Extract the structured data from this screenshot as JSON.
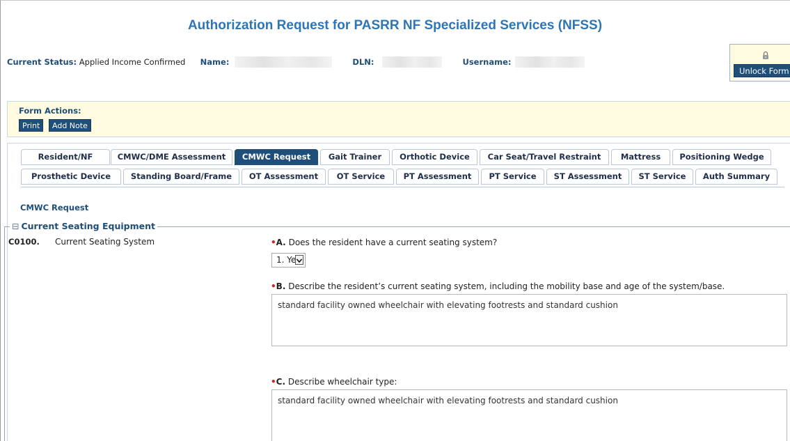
{
  "header": {
    "title": "Authorization Request for PASRR NF Specialized Services (NFSS)",
    "status_label": "Current Status:",
    "status_value": "Applied Income Confirmed",
    "name_label": "Name:",
    "dln_label": "DLN:",
    "username_label": "Username:"
  },
  "unlock": {
    "button_label": "Unlock Form"
  },
  "form_actions": {
    "header": "Form Actions:",
    "print_label": "Print",
    "add_note_label": "Add Note"
  },
  "tabs": {
    "row1": [
      "Resident/NF",
      "CMWC/DME Assessment",
      "CMWC Request",
      "Gait Trainer",
      "Orthotic Device",
      "Car Seat/Travel Restraint",
      "Mattress",
      "Positioning Wedge"
    ],
    "row2": [
      "Prosthetic Device",
      "Standing Board/Frame",
      "OT Assessment",
      "OT Service",
      "PT Assessment",
      "PT Service",
      "ST Assessment",
      "ST Service",
      "Auth Summary"
    ],
    "active": "CMWC Request"
  },
  "section": {
    "title": "CMWC Request",
    "fieldset_legend": "Current Seating Equipment",
    "toggle_glyph": "⊟",
    "item_code": "C0100.",
    "item_label": "Current Seating System"
  },
  "questions": {
    "required_mark": "•",
    "a": {
      "letter": "A.",
      "text": "Does the resident have a current seating system?",
      "value": "1. Yes"
    },
    "b": {
      "letter": "B.",
      "text": "Describe the resident’s current seating system, including the mobility base and age of the system/base.",
      "value": "standard facility owned wheelchair with elevating footrests and standard cushion"
    },
    "c": {
      "letter": "C.",
      "text": "Describe wheelchair type:",
      "value": "standard facility owned wheelchair with elevating footrests and standard cushion"
    }
  },
  "colors": {
    "title_blue": "#2e75b6",
    "navy": "#1f4e79",
    "panel_yellow": "#fffbe0",
    "required_red": "#d62020"
  }
}
